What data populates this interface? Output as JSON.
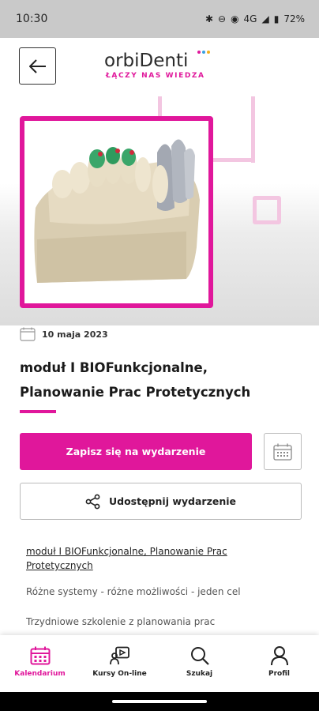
{
  "status": {
    "time": "10:30",
    "network": "4G",
    "battery": "72%"
  },
  "header": {
    "logo_main": "orbiDenti",
    "logo_tagline": "ŁĄCZY NAS WIEDZA",
    "logo_dot_colors": [
      "#e0179b",
      "#3aa0e0",
      "#f2b01e"
    ]
  },
  "event": {
    "date": "10 maja 2023",
    "title": "moduł I BIOFunkcjonalne, Planowanie Prac Protetycznych",
    "register_label": "Zapisz się na wydarzenie",
    "share_label": "Udostępnij wydarzenie",
    "description_title": "moduł I BIOFunkcjonalne, Planowanie Prac Protetycznych",
    "description_p1": "Różne systemy - różne możliwości - jeden cel",
    "description_p2": "Trzydniowe szkolenie z planowania prac"
  },
  "nav": {
    "items": [
      {
        "label": "Kalendarium",
        "icon": "calendar-icon",
        "active": true
      },
      {
        "label": "Kursy On-line",
        "icon": "online-course-icon",
        "active": false
      },
      {
        "label": "Szukaj",
        "icon": "search-icon",
        "active": false
      },
      {
        "label": "Profil",
        "icon": "profile-icon",
        "active": false
      }
    ]
  },
  "colors": {
    "accent": "#e0179b",
    "accent_light": "#f3c6e1"
  }
}
